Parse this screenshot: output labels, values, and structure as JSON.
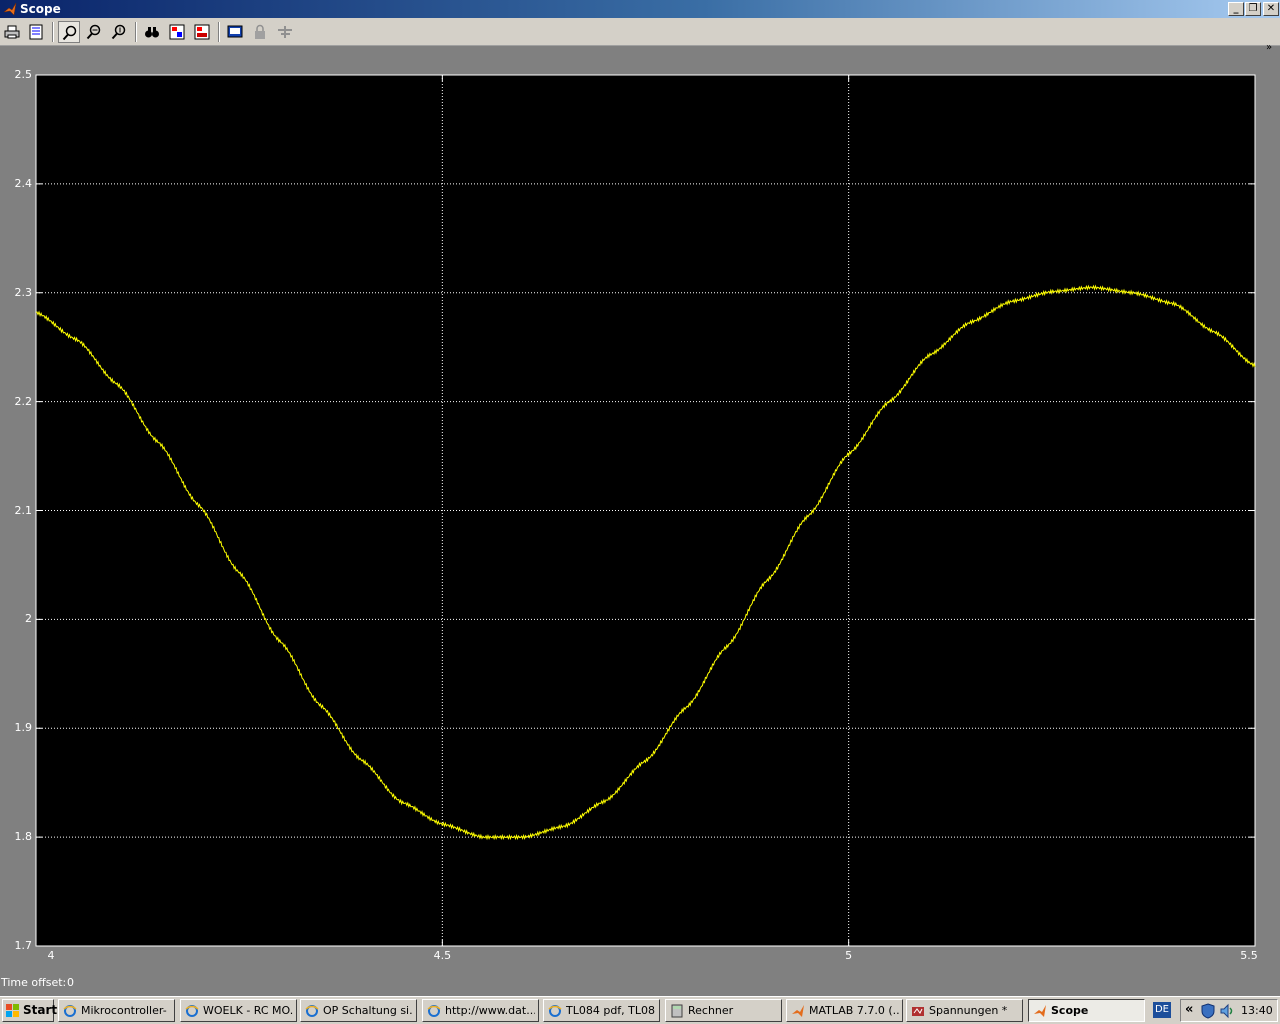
{
  "window": {
    "title": "Scope",
    "minimize": "_",
    "maximize": "❐",
    "close": "✕"
  },
  "toolbar": {
    "buttons": [
      {
        "name": "print-icon"
      },
      {
        "name": "parameters-icon"
      },
      {
        "name": "zoom-icon",
        "pressed": true
      },
      {
        "name": "zoom-x-icon"
      },
      {
        "name": "zoom-y-icon"
      },
      {
        "name": "autoscale-icon"
      },
      {
        "name": "save-axes-icon"
      },
      {
        "name": "restore-axes-icon"
      },
      {
        "name": "floating-scope-icon"
      },
      {
        "name": "lock-icon"
      },
      {
        "name": "signal-selector-icon"
      }
    ],
    "chevron": "»"
  },
  "chart_data": {
    "type": "line",
    "xlim": [
      4,
      5.5
    ],
    "ylim": [
      1.7,
      2.5
    ],
    "xticks": [
      "4",
      "4.5",
      "5",
      "5.5"
    ],
    "yticks": [
      "2.5",
      "2.4",
      "2.3",
      "2.2",
      "2.1",
      "2",
      "1.9",
      "1.8",
      "1.7"
    ],
    "grid": true,
    "colors": {
      "background": "#000000",
      "line": "#ffff00",
      "grid": "#ffffff"
    },
    "series": [
      {
        "x": [
          4.0,
          4.05,
          4.1,
          4.15,
          4.2,
          4.25,
          4.3,
          4.35,
          4.4,
          4.45,
          4.5,
          4.55,
          4.6,
          4.65,
          4.7,
          4.75,
          4.8,
          4.85,
          4.9,
          4.95,
          5.0,
          5.05,
          5.1,
          5.15,
          5.2,
          5.25,
          5.3,
          5.35,
          5.4,
          5.45,
          5.5
        ],
        "y": [
          2.282,
          2.257,
          2.216,
          2.163,
          2.105,
          2.043,
          1.98,
          1.921,
          1.871,
          1.832,
          1.812,
          1.8,
          1.8,
          1.81,
          1.833,
          1.87,
          1.919,
          1.975,
          2.036,
          2.095,
          2.152,
          2.2,
          2.243,
          2.273,
          2.292,
          2.301,
          2.305,
          2.3,
          2.29,
          2.264,
          2.233
        ]
      }
    ]
  },
  "status": {
    "time_offset_label": "Time offset:",
    "time_offset_value": "0"
  },
  "taskbar": {
    "start": "Start",
    "tasks": [
      {
        "label": "Mikrocontroller- ...",
        "icon": "ie-icon"
      },
      {
        "label": "WOELK - RC MO...",
        "icon": "ie-icon"
      },
      {
        "label": "OP Schaltung si...",
        "icon": "ie-icon"
      },
      {
        "label": "http://www.dat...",
        "icon": "ie-icon"
      },
      {
        "label": "TL084 pdf, TL08...",
        "icon": "ie-icon"
      },
      {
        "label": "Rechner",
        "icon": "calculator-icon"
      },
      {
        "label": "MATLAB  7.7.0 (...",
        "icon": "matlab-icon"
      },
      {
        "label": "Spannungen *",
        "icon": "simulink-icon"
      },
      {
        "label": "Scope",
        "icon": "scope-icon",
        "active": true
      }
    ],
    "language": "DE",
    "tray_chevron": "«",
    "clock": "13:40"
  }
}
